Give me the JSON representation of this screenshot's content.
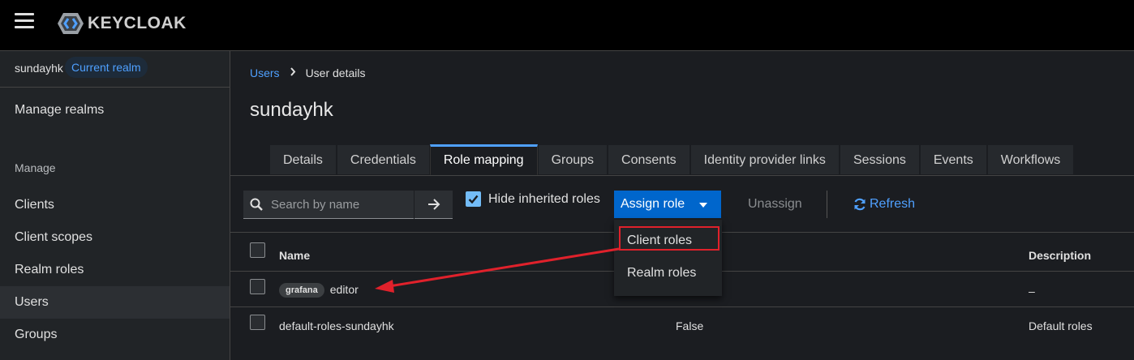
{
  "header": {
    "logo_text": "KEYCLOAK",
    "menu_icon": "hamburger-icon"
  },
  "sidebar": {
    "realm_name": "sundayhk",
    "realm_badge": "Current realm",
    "manage_realms": "Manage realms",
    "section_title": "Manage",
    "items": [
      {
        "label": "Clients",
        "active": false
      },
      {
        "label": "Client scopes",
        "active": false
      },
      {
        "label": "Realm roles",
        "active": false
      },
      {
        "label": "Users",
        "active": true
      },
      {
        "label": "Groups",
        "active": false
      }
    ]
  },
  "breadcrumb": {
    "parent": "Users",
    "current": "User details"
  },
  "page_title": "sundayhk",
  "tabs": [
    {
      "label": "Details",
      "active": false
    },
    {
      "label": "Credentials",
      "active": false
    },
    {
      "label": "Role mapping",
      "active": true
    },
    {
      "label": "Groups",
      "active": false
    },
    {
      "label": "Consents",
      "active": false
    },
    {
      "label": "Identity provider links",
      "active": false
    },
    {
      "label": "Sessions",
      "active": false
    },
    {
      "label": "Events",
      "active": false
    },
    {
      "label": "Workflows",
      "active": false
    }
  ],
  "toolbar": {
    "search_placeholder": "Search by name",
    "hide_inherited_label": "Hide inherited roles",
    "hide_inherited_checked": true,
    "assign_label": "Assign role",
    "unassign_label": "Unassign",
    "refresh_label": "Refresh"
  },
  "assign_dropdown": {
    "items": [
      "Client roles",
      "Realm roles"
    ],
    "highlighted": "Client roles"
  },
  "table": {
    "columns": {
      "name": "Name",
      "description": "Description"
    },
    "rows": [
      {
        "client": "grafana",
        "name": "editor",
        "inherited": "",
        "description": "–"
      },
      {
        "client": "",
        "name": "default-roles-sundayhk",
        "inherited": "False",
        "description": "Default roles"
      }
    ]
  },
  "colors": {
    "accent": "#4fa0ff",
    "primary_button": "#0066cc",
    "annotation_red": "#e0212b"
  }
}
